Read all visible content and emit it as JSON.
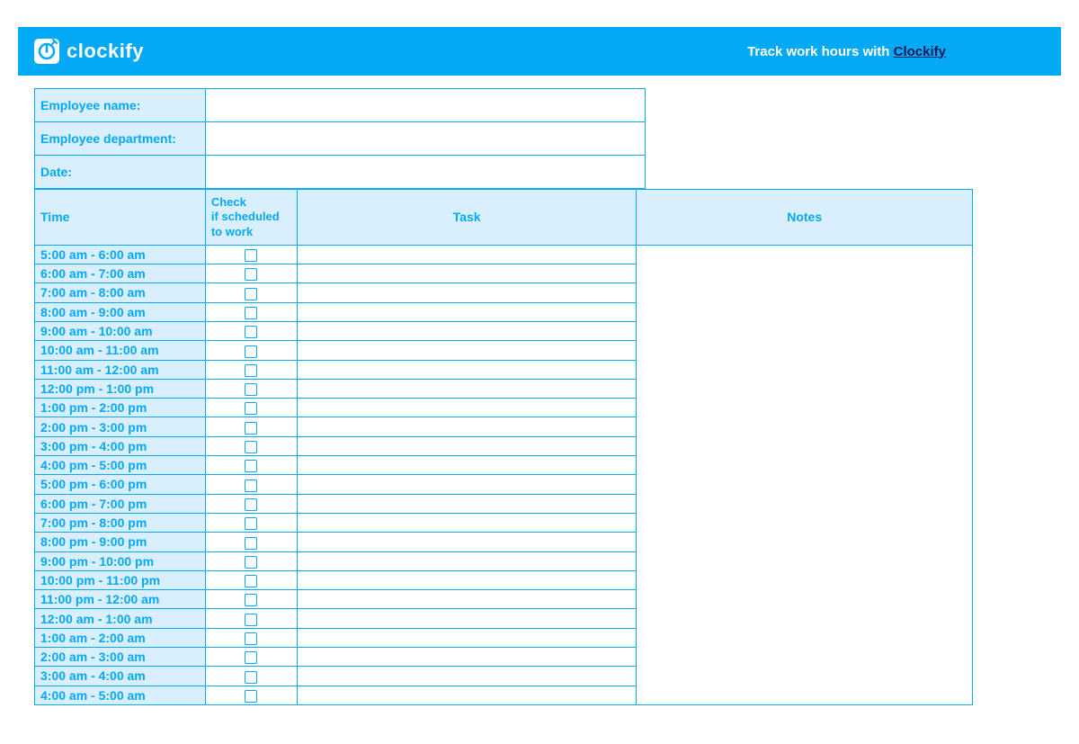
{
  "header": {
    "brand": "clockify",
    "tagline_prefix": "Track work hours with ",
    "tagline_link": "Clockify"
  },
  "info": {
    "name_label": "Employee name:",
    "name_value": "",
    "dept_label": "Employee department:",
    "dept_value": "",
    "date_label": "Date:",
    "date_value": ""
  },
  "columns": {
    "time": "Time",
    "check": "Check\nif scheduled\nto work",
    "task": "Task",
    "notes": "Notes"
  },
  "rows": [
    {
      "time": "5:00 am - 6:00 am"
    },
    {
      "time": "6:00 am - 7:00 am"
    },
    {
      "time": "7:00 am - 8:00 am"
    },
    {
      "time": "8:00 am - 9:00 am"
    },
    {
      "time": "9:00 am - 10:00 am"
    },
    {
      "time": "10:00 am - 11:00 am"
    },
    {
      "time": "11:00 am - 12:00 am"
    },
    {
      "time": "12:00 pm - 1:00 pm"
    },
    {
      "time": "1:00 pm - 2:00 pm"
    },
    {
      "time": "2:00 pm - 3:00 pm"
    },
    {
      "time": "3:00 pm - 4:00 pm"
    },
    {
      "time": "4:00 pm - 5:00 pm"
    },
    {
      "time": "5:00 pm - 6:00 pm"
    },
    {
      "time": "6:00 pm - 7:00 pm"
    },
    {
      "time": "7:00 pm - 8:00 pm"
    },
    {
      "time": "8:00 pm - 9:00 pm"
    },
    {
      "time": "9:00 pm - 10:00 pm"
    },
    {
      "time": "10:00 pm - 11:00 pm"
    },
    {
      "time": "11:00 pm - 12:00 am"
    },
    {
      "time": "12:00 am - 1:00 am"
    },
    {
      "time": "1:00 am - 2:00 am"
    },
    {
      "time": "2:00 am - 3:00 am"
    },
    {
      "time": "3:00 am - 4:00 am"
    },
    {
      "time": "4:00 am - 5:00 am"
    }
  ]
}
